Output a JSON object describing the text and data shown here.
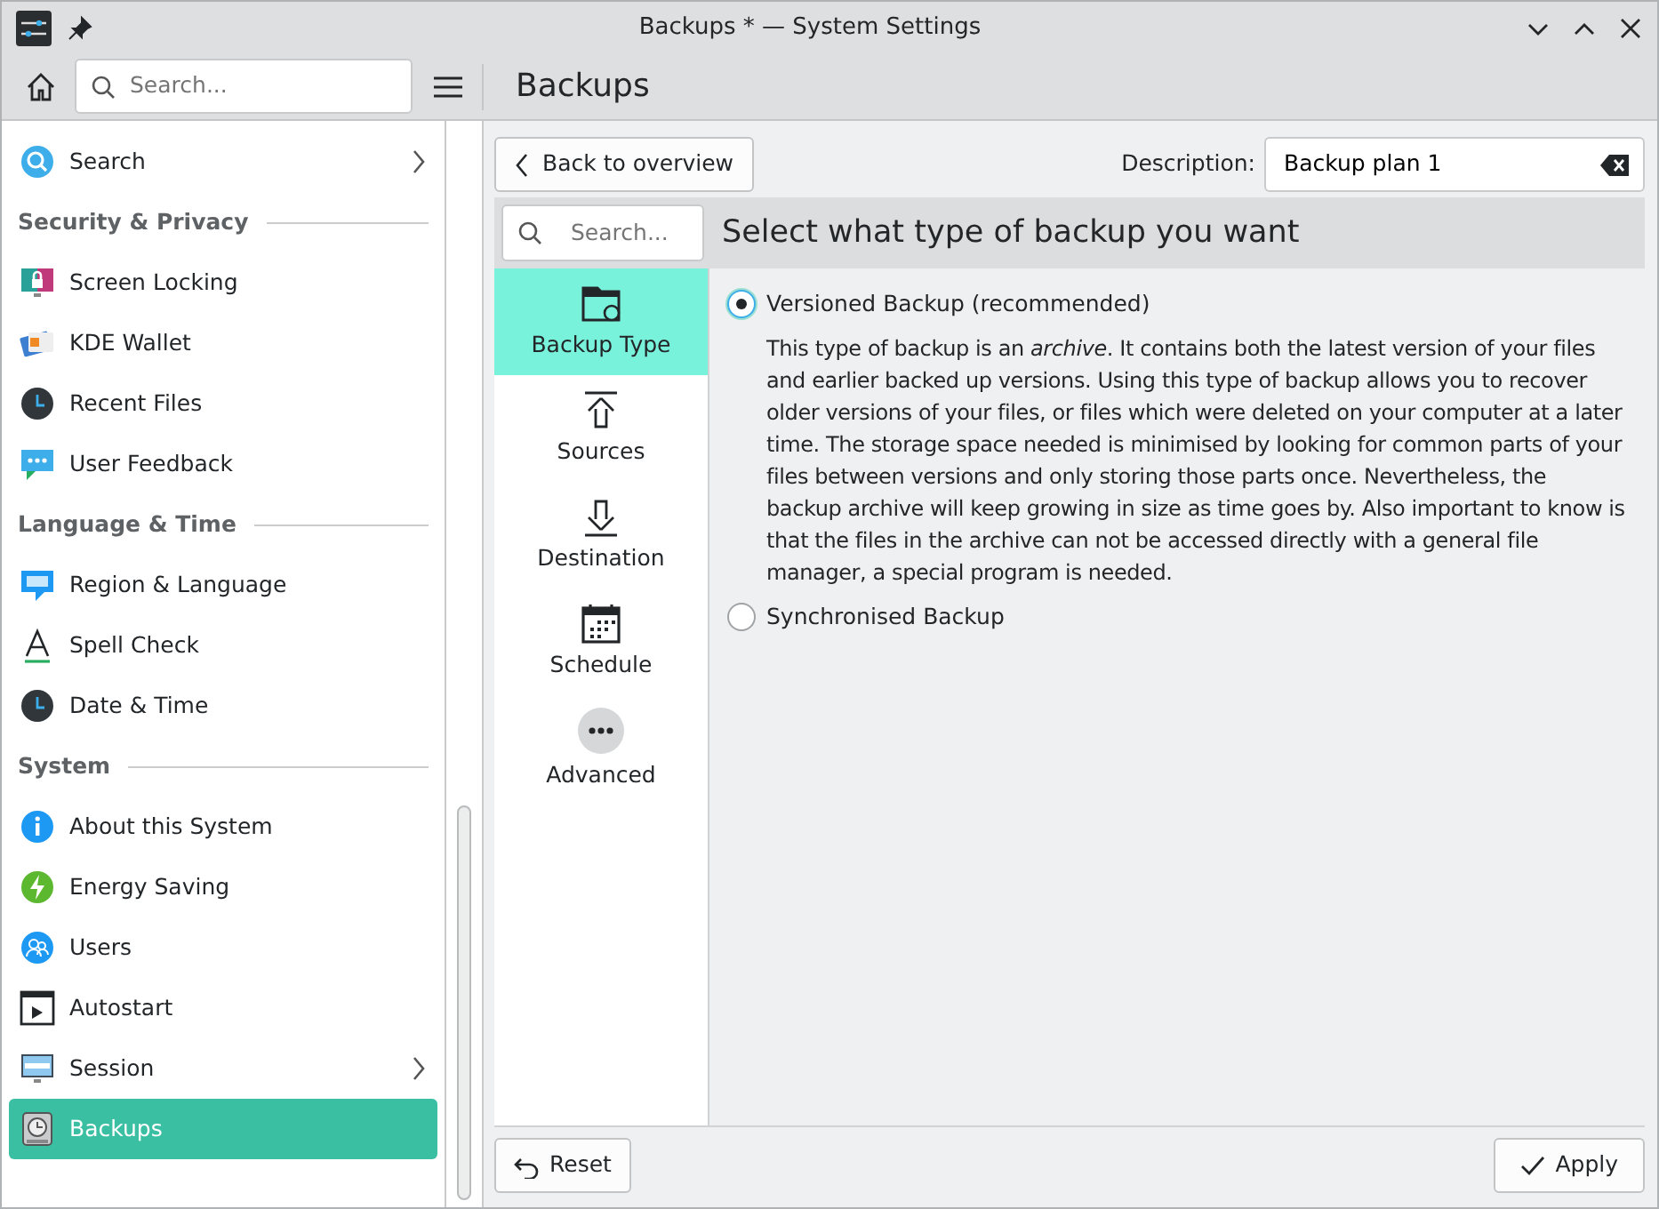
{
  "window": {
    "title": "Backups * — System Settings"
  },
  "toolbar": {
    "search_placeholder": "Search...",
    "page_title": "Backups"
  },
  "sidebar": {
    "items": [
      {
        "kind": "item",
        "label": "Search",
        "arrow": true,
        "selected": false
      },
      {
        "kind": "heading",
        "label": "Security & Privacy"
      },
      {
        "kind": "item",
        "label": "Screen Locking",
        "arrow": false,
        "selected": false
      },
      {
        "kind": "item",
        "label": "KDE Wallet",
        "arrow": false,
        "selected": false
      },
      {
        "kind": "item",
        "label": "Recent Files",
        "arrow": false,
        "selected": false
      },
      {
        "kind": "item",
        "label": "User Feedback",
        "arrow": false,
        "selected": false
      },
      {
        "kind": "heading",
        "label": "Language & Time"
      },
      {
        "kind": "item",
        "label": "Region & Language",
        "arrow": false,
        "selected": false
      },
      {
        "kind": "item",
        "label": "Spell Check",
        "arrow": false,
        "selected": false
      },
      {
        "kind": "item",
        "label": "Date & Time",
        "arrow": false,
        "selected": false
      },
      {
        "kind": "heading",
        "label": "System"
      },
      {
        "kind": "item",
        "label": "About this System",
        "arrow": false,
        "selected": false
      },
      {
        "kind": "item",
        "label": "Energy Saving",
        "arrow": false,
        "selected": false
      },
      {
        "kind": "item",
        "label": "Users",
        "arrow": false,
        "selected": false
      },
      {
        "kind": "item",
        "label": "Autostart",
        "arrow": false,
        "selected": false
      },
      {
        "kind": "item",
        "label": "Session",
        "arrow": true,
        "selected": false
      },
      {
        "kind": "item",
        "label": "Backups",
        "arrow": false,
        "selected": true
      }
    ]
  },
  "module": {
    "back_button": "Back to overview",
    "description_label": "Description:",
    "description_value": "Backup plan 1",
    "search_placeholder": "Search...",
    "heading": "Select what type of backup you want",
    "steps": [
      {
        "label": "Backup Type",
        "selected": true
      },
      {
        "label": "Sources",
        "selected": false
      },
      {
        "label": "Destination",
        "selected": false
      },
      {
        "label": "Schedule",
        "selected": false
      },
      {
        "label": "Advanced",
        "selected": false
      }
    ],
    "options": [
      {
        "label": "Versioned Backup (recommended)",
        "selected": true,
        "description": "This type of backup is an *archive*. It contains both the latest version of your files and earlier backed up versions. Using this type of backup allows you to recover older versions of your files, or files which were deleted on your computer at a later time. The storage space needed is minimised by looking for common parts of your files between versions and only storing those parts once. Nevertheless, the backup archive will keep growing in size as time goes by. Also important to know is that the files in the archive can not be accessed directly with a general file manager, a special program is needed."
      },
      {
        "label": "Synchronised Backup",
        "selected": false
      }
    ],
    "buttons": {
      "reset": "Reset",
      "apply": "Apply"
    }
  }
}
